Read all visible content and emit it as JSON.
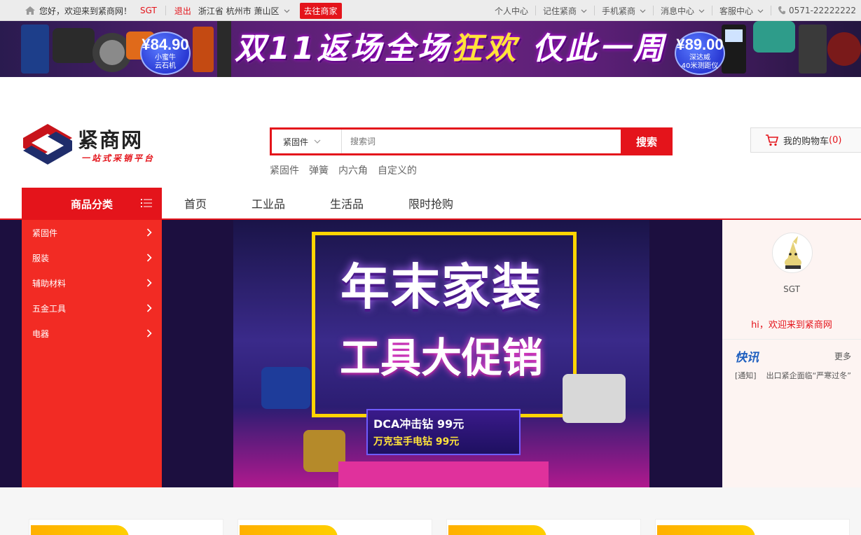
{
  "topbar": {
    "greeting": "您好，欢迎来到紧商网！",
    "username": "SGT",
    "logout": "退出",
    "location": "浙江省 杭州市 萧山区",
    "go_merchant": "去往商家",
    "right_items": [
      "个人中心",
      "记住紧商",
      "手机紧商",
      "消息中心",
      "客服中心"
    ],
    "phone": "0571-22222222"
  },
  "promo": {
    "left_price": "¥84.90",
    "left_caption_1": "小蜜牛",
    "left_caption_2": "云石机",
    "slogan_parts": [
      "双11返场",
      "全场",
      "狂欢",
      "仅此一周"
    ],
    "right_price": "¥89.00",
    "right_caption_1": "深达威",
    "right_caption_2": "40米测距仪"
  },
  "header": {
    "logo_name": "紧商网",
    "logo_tagline": "一站式采销平台",
    "search_category": "紧固件",
    "search_placeholder": "搜索词",
    "search_button": "搜索",
    "hot_words": [
      "紧固件",
      "弹簧",
      "内六角",
      "自定义的"
    ],
    "cart_label": "我的购物车",
    "cart_count": "(0)"
  },
  "nav": {
    "category_title": "商品分类",
    "links": [
      "首页",
      "工业品",
      "生活品",
      "限时抢购"
    ]
  },
  "sidebar": {
    "items": [
      "紧固件",
      "服装",
      "辅助材料",
      "五金工具",
      "电器"
    ]
  },
  "hero": {
    "title_1": "年末家装",
    "title_2": "工具大促销",
    "deal_1": "DCA冲击钻 99元",
    "deal_2": "万克宝手电钻 99元"
  },
  "user_panel": {
    "username": "SGT",
    "welcome": "hi，欢迎来到紧商网",
    "news_title": "快讯",
    "more": "更多",
    "news_tag": "[通知]",
    "news_text": "出口紧企面临“严寒过冬”"
  },
  "colors": {
    "brand_red": "#e4141b",
    "sidebar_red": "#f22b24",
    "news_blue": "#1e5fbf"
  }
}
